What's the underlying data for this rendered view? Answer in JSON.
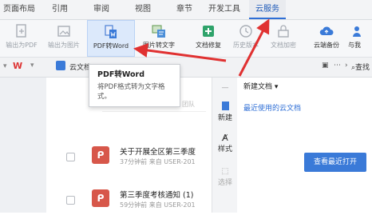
{
  "tabs": [
    "页面布局",
    "引用",
    "审阅",
    "视图",
    "章节",
    "开发工具",
    "云服务"
  ],
  "tools": [
    {
      "label": "输出为PDF",
      "icon": "pdf-export-icon"
    },
    {
      "label": "输出为图片",
      "icon": "image-export-icon"
    },
    {
      "label": "PDF转Word",
      "icon": "pdf-to-word-icon"
    },
    {
      "label": "图片转文字",
      "icon": "image-to-text-icon"
    },
    {
      "label": "文档修复",
      "icon": "repair-icon"
    },
    {
      "label": "历史版本",
      "icon": "history-icon"
    },
    {
      "label": "文档加密",
      "icon": "encrypt-icon"
    },
    {
      "label": "云端备份",
      "icon": "cloud-backup-icon"
    },
    {
      "label": "与我",
      "icon": "share-icon"
    }
  ],
  "bar2": {
    "cloud_docs": "云文档",
    "search": "查找"
  },
  "tooltip": {
    "title": "PDF转Word",
    "desc": "将PDF格式转为文字格式。"
  },
  "team_hint": "团队",
  "docs": [
    {
      "title": "关于开展全区第三季度",
      "meta": "37分钟前  来自 USER-201"
    },
    {
      "title": "第三季度考核通知 (1)",
      "meta": "59分钟前  来自 USER-201"
    }
  ],
  "strip": {
    "new": "新建",
    "style": "样式",
    "select": "选择"
  },
  "panel": {
    "new_doc": "新建文档",
    "recent": "最近使用的云文档",
    "open_recent": "查看最近打开"
  },
  "colors": {
    "accent": "#2f6fd6",
    "arrow": "#e03131",
    "pdf": "#d7574a"
  }
}
